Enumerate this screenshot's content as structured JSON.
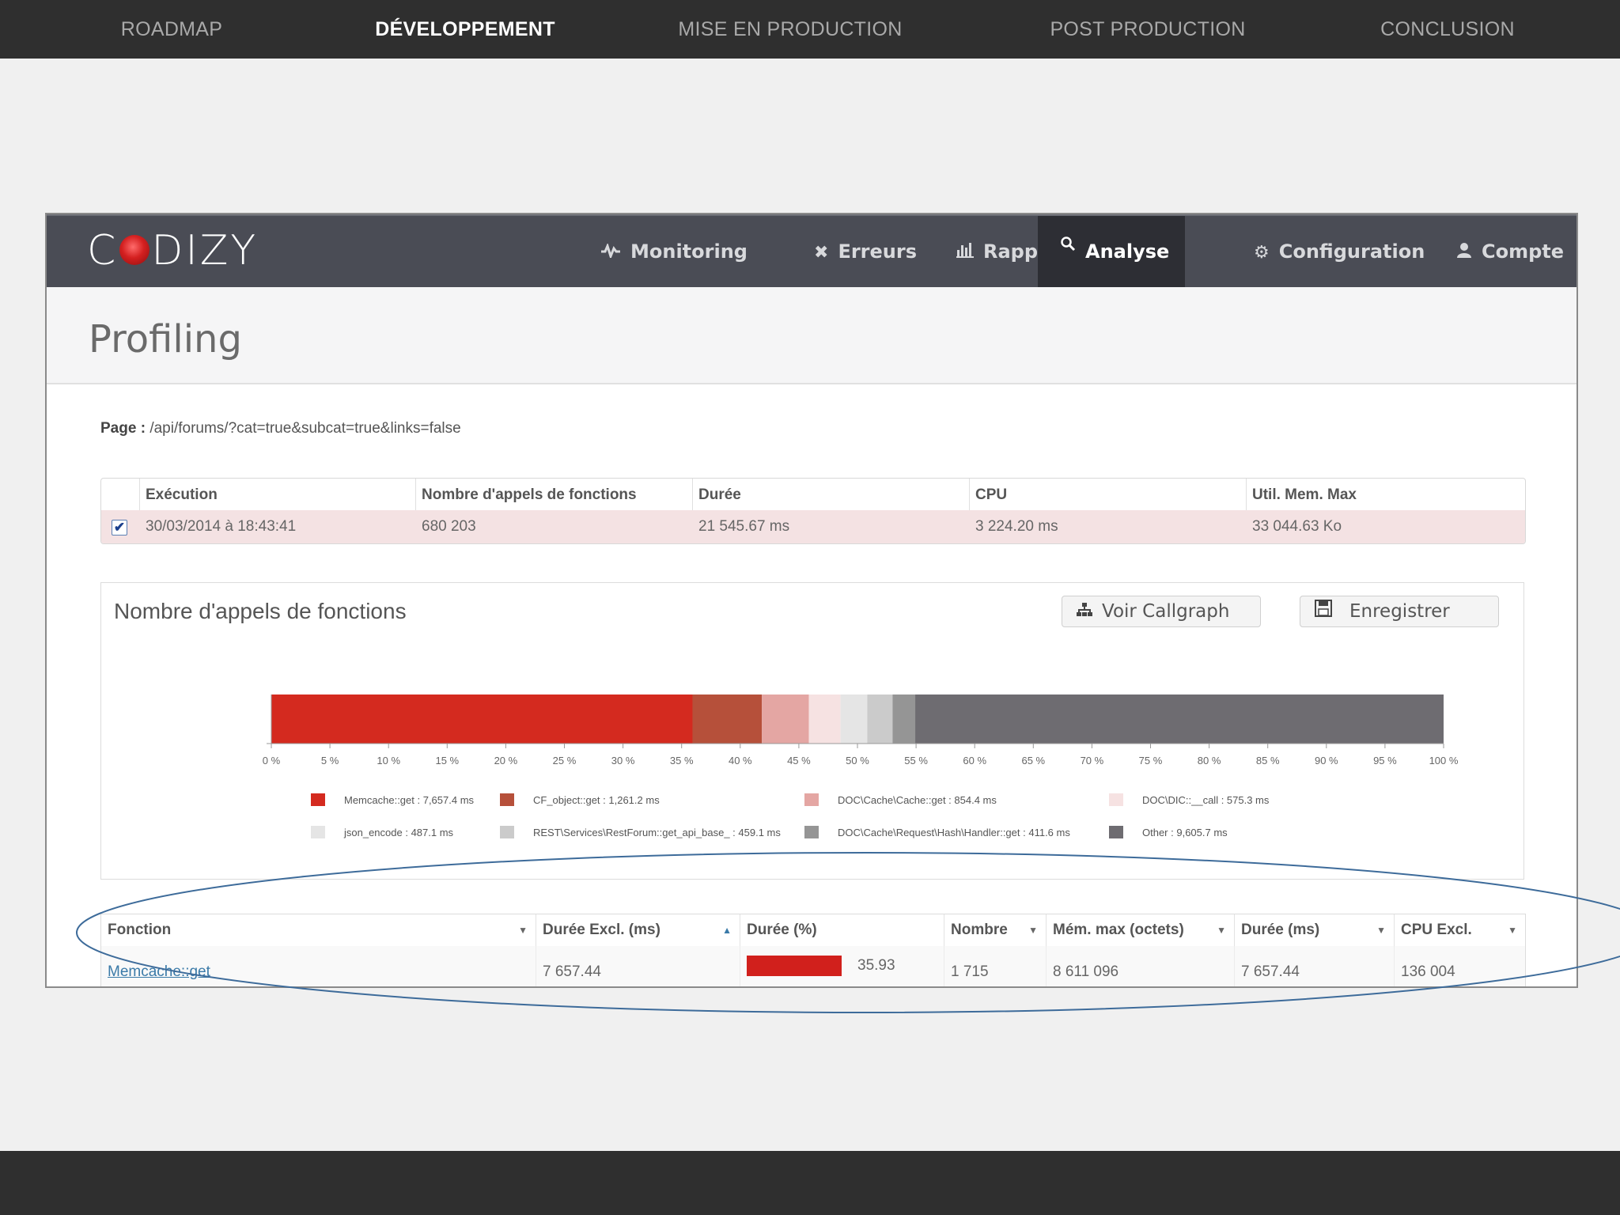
{
  "slide_nav": {
    "items": [
      {
        "label": "ROADMAP",
        "active": false
      },
      {
        "label": "DÉVELOPPEMENT",
        "active": true
      },
      {
        "label": "MISE EN PRODUCTION",
        "active": false
      },
      {
        "label": "POST PRODUCTION",
        "active": false
      },
      {
        "label": "CONCLUSION",
        "active": false
      }
    ]
  },
  "app": {
    "logo": {
      "prefix": "C",
      "suffix": "DIZY"
    },
    "menu": [
      {
        "label": "Monitoring",
        "icon": "activity-icon"
      },
      {
        "label": "Erreurs",
        "icon": "close-icon"
      },
      {
        "label": "Rapport",
        "icon": "bar-chart-icon"
      },
      {
        "label": "Analyse",
        "icon": "search-icon",
        "active": true
      },
      {
        "label": "Configuration",
        "icon": "gear-icon"
      },
      {
        "label": "Compte",
        "icon": "user-icon"
      }
    ],
    "page_title": "Profiling",
    "page_label": "Page :",
    "page_value": "/api/forums/?cat=true&subcat=true&links=false"
  },
  "exec_table": {
    "headers": [
      "Exécution",
      "Nombre d'appels de fonctions",
      "Durée",
      "CPU",
      "Util. Mem. Max"
    ],
    "row": {
      "checked": true,
      "check_glyph": "✔",
      "cells": [
        "30/03/2014 à 18:43:41",
        "680 203",
        "21 545.67 ms",
        "3 224.20 ms",
        "33 044.63 Ko"
      ]
    }
  },
  "chart_panel": {
    "title": "Nombre d'appels de fonctions",
    "buttons": [
      {
        "label": "Voir Callgraph",
        "icon": "sitemap-icon"
      },
      {
        "label": "Enregistrer",
        "icon": "save-icon"
      }
    ]
  },
  "chart_data": {
    "type": "bar",
    "orientation": "horizontal",
    "stacked": true,
    "unit": "ms",
    "xlim": [
      0,
      100
    ],
    "x_ticks": [
      "0 %",
      "5 %",
      "10 %",
      "15 %",
      "20 %",
      "25 %",
      "30 %",
      "35 %",
      "40 %",
      "45 %",
      "50 %",
      "55 %",
      "60 %",
      "65 %",
      "70 %",
      "75 %",
      "80 %",
      "85 %",
      "90 %",
      "95 %",
      "100 %"
    ],
    "legend_placement": "bottom",
    "series": [
      {
        "name": "Memcache::get",
        "value": 7657.4,
        "value_label": "7,657.4 ms",
        "color": "#d42a1f"
      },
      {
        "name": "CF_object::get",
        "value": 1261.2,
        "value_label": "1,261.2 ms",
        "color": "#b6503a"
      },
      {
        "name": "DOC\\Cache\\Cache::get",
        "value": 854.4,
        "value_label": "854.4 ms",
        "color": "#e4a6a3"
      },
      {
        "name": "DOC\\DIC::__call",
        "value": 575.3,
        "value_label": "575.3 ms",
        "color": "#f6e2e2"
      },
      {
        "name": "json_encode",
        "value": 487.1,
        "value_label": "487.1 ms",
        "color": "#e5e5e5"
      },
      {
        "name": "REST\\Services\\RestForum::get_api_base_",
        "value": 459.1,
        "value_label": "459.1 ms",
        "color": "#cbcbcb"
      },
      {
        "name": "DOC\\Cache\\Request\\Hash\\Handler::get",
        "value": 411.6,
        "value_label": "411.6 ms",
        "color": "#959595"
      },
      {
        "name": "Other",
        "value": 9605.7,
        "value_label": "9,605.7 ms",
        "color": "#6e6c71"
      }
    ]
  },
  "func_table": {
    "headers": [
      {
        "label": "Fonction",
        "sort": "▼"
      },
      {
        "label": "Durée Excl. (ms)",
        "sort": "▲"
      },
      {
        "label": "Durée (%)",
        "sort": ""
      },
      {
        "label": "Nombre",
        "sort": "▼"
      },
      {
        "label": "Mém. max (octets)",
        "sort": "▼"
      },
      {
        "label": "Durée (ms)",
        "sort": "▼"
      },
      {
        "label": "CPU Excl.",
        "sort": "▼"
      }
    ],
    "row": {
      "function": "Memcache::get",
      "duree_excl": "7 657.44",
      "duree_pct": "35.93",
      "duree_pct_value": 35.93,
      "nombre": "1 715",
      "mem_max": "8 611 096",
      "duree": "7 657.44",
      "cpu_excl": "136 004"
    }
  },
  "colors": {
    "slide_bar": "#2f2f2f",
    "app_header": "#4a4c55",
    "active_menu": "#2d2e34",
    "accent_red": "#d1201c",
    "highlight_row": "#f4e2e3",
    "annotation_ellipse": "#3d6b9a"
  }
}
